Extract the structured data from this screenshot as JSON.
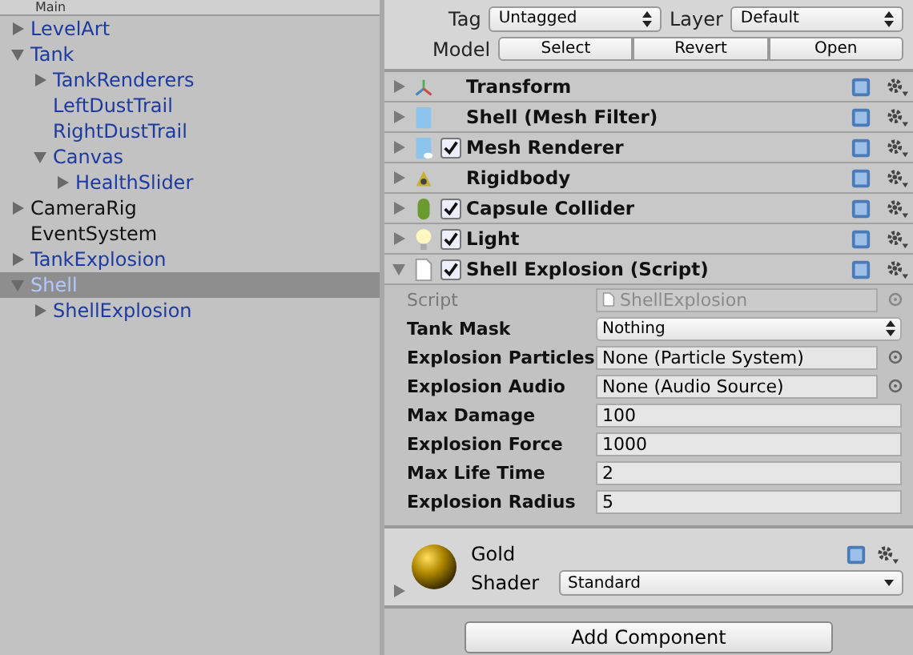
{
  "hierarchy": {
    "title": "Main",
    "items": [
      {
        "label": "LevelArt",
        "prefab": true,
        "expanded": false,
        "selected": false
      },
      {
        "label": "Tank",
        "prefab": true,
        "expanded": true,
        "selected": false,
        "children": [
          {
            "label": "TankRenderers",
            "prefab": true,
            "expanded": false,
            "selected": false
          },
          {
            "label": "LeftDustTrail",
            "prefab": true,
            "selected": false
          },
          {
            "label": "RightDustTrail",
            "prefab": true,
            "selected": false
          },
          {
            "label": "Canvas",
            "prefab": true,
            "expanded": true,
            "selected": false,
            "children": [
              {
                "label": "HealthSlider",
                "prefab": true,
                "expanded": false,
                "selected": false
              }
            ]
          }
        ]
      },
      {
        "label": "CameraRig",
        "prefab": false,
        "expanded": false,
        "selected": false
      },
      {
        "label": "EventSystem",
        "prefab": false,
        "selected": false
      },
      {
        "label": "TankExplosion",
        "prefab": true,
        "expanded": false,
        "selected": false
      },
      {
        "label": "Shell",
        "prefab": true,
        "expanded": true,
        "selected": true,
        "children": [
          {
            "label": "ShellExplosion",
            "prefab": true,
            "expanded": false,
            "selected": false
          }
        ]
      }
    ]
  },
  "inspector": {
    "tag": {
      "label": "Tag",
      "value": "Untagged"
    },
    "layer": {
      "label": "Layer",
      "value": "Default"
    },
    "model": {
      "label": "Model",
      "buttons": [
        "Select",
        "Revert",
        "Open"
      ]
    },
    "components": [
      {
        "name": "Transform",
        "expanded": false
      },
      {
        "name": "Shell (Mesh Filter)",
        "expanded": false
      },
      {
        "name": "Mesh Renderer",
        "expanded": false,
        "enabled": true
      },
      {
        "name": "Rigidbody",
        "expanded": false
      },
      {
        "name": "Capsule Collider",
        "expanded": false,
        "enabled": true
      },
      {
        "name": "Light",
        "expanded": false,
        "enabled": true
      },
      {
        "name": "Shell Explosion (Script)",
        "expanded": true,
        "enabled": true,
        "fields": [
          {
            "label": "Script",
            "kind": "script",
            "value": "ShellExplosion"
          },
          {
            "label": "Tank Mask",
            "kind": "dropdown",
            "value": "Nothing"
          },
          {
            "label": "Explosion Particles",
            "kind": "object",
            "value": "None (Particle System)"
          },
          {
            "label": "Explosion Audio",
            "kind": "object",
            "value": "None (Audio Source)"
          },
          {
            "label": "Max Damage",
            "kind": "number",
            "value": "100"
          },
          {
            "label": "Explosion Force",
            "kind": "number",
            "value": "1000"
          },
          {
            "label": "Max Life Time",
            "kind": "number",
            "value": "2"
          },
          {
            "label": "Explosion Radius",
            "kind": "number",
            "value": "5"
          }
        ]
      }
    ],
    "material": {
      "name": "Gold",
      "shader_label": "Shader",
      "shader": "Standard",
      "expanded": false
    },
    "add_button": "Add Component"
  }
}
